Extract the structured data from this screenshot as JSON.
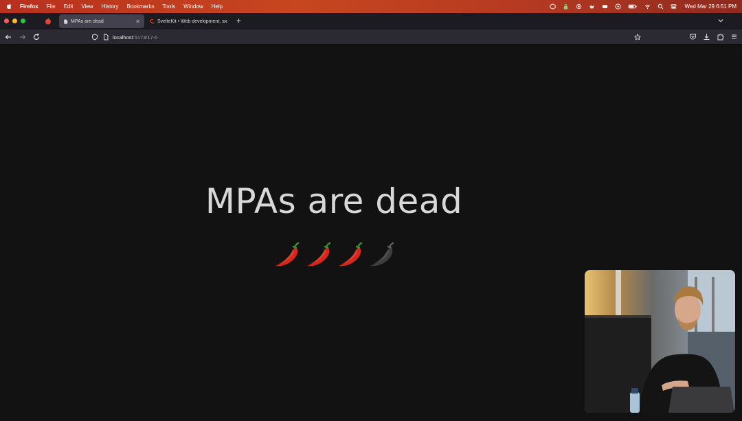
{
  "menubar": {
    "items": [
      "Firefox",
      "File",
      "Edit",
      "View",
      "History",
      "Bookmarks",
      "Tools",
      "Window",
      "Help"
    ],
    "clock": "Wed Mar 29  6:51 PM"
  },
  "tabs": [
    {
      "title": "MPAs are dead"
    },
    {
      "title": "SvelteKit • Web development, s"
    }
  ],
  "url": {
    "host": "localhost",
    "path": ":5173/17-0"
  },
  "slide": {
    "title": "MPAs are dead",
    "peppers": [
      {
        "style": "red"
      },
      {
        "style": "red"
      },
      {
        "style": "red"
      },
      {
        "style": "gray"
      }
    ]
  },
  "colors": {
    "accent_menubar": "#c7461f",
    "tab_active": "#42414d",
    "background": "#121212"
  }
}
